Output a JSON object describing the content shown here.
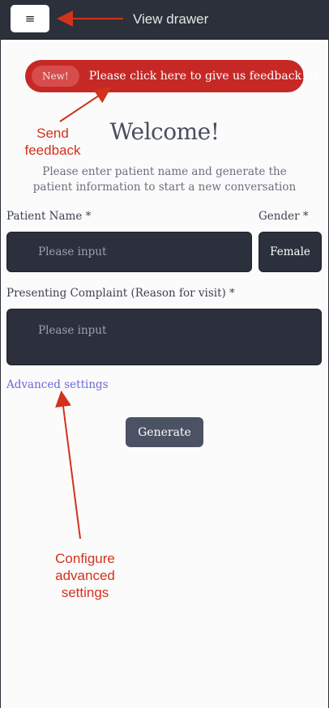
{
  "topbar": {
    "menu_icon": "hamburger-icon",
    "menu_glyph": "≡"
  },
  "feedback": {
    "badge": "New!",
    "text": "Please click here to give us feedback!",
    "chevron_icon": "chevron-right-icon",
    "chevron_glyph": "›"
  },
  "main": {
    "title": "Welcome!",
    "subtitle": "Please enter patient name and generate the patient information to start a new conversation"
  },
  "form": {
    "patient_name_label": "Patient Name *",
    "patient_name_placeholder": "Please input",
    "gender_label": "Gender *",
    "gender_value": "Female",
    "complaint_label": "Presenting Complaint (Reason for visit) *",
    "complaint_placeholder": "Please input",
    "advanced_settings": "Advanced settings",
    "generate_label": "Generate"
  },
  "annotations": {
    "view_drawer": "View drawer",
    "send_feedback_line1": "Send",
    "send_feedback_line2": "feedback",
    "configure_line1": "Configure",
    "configure_line2": "advanced",
    "configure_line3": "settings"
  },
  "colors": {
    "topbar": "#2b303b",
    "feedback_banner": "#c62826",
    "input_bg": "#2b303c",
    "link": "#6a68d8",
    "generate_button": "#4a5263",
    "annotation": "#d2321c"
  }
}
